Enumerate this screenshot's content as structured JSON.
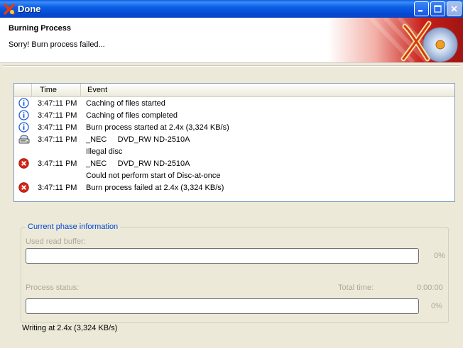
{
  "window": {
    "title": "Done",
    "controls": [
      "minimize",
      "maximize",
      "close"
    ]
  },
  "header": {
    "title": "Burning Process",
    "subtitle": "Sorry! Burn process failed..."
  },
  "event_list": {
    "columns": [
      "Time",
      "Event"
    ],
    "rows": [
      {
        "icon": "info-icon",
        "time": "3:47:11 PM",
        "event": "Caching of files started"
      },
      {
        "icon": "info-icon",
        "time": "3:47:11 PM",
        "event": "Caching of files completed"
      },
      {
        "icon": "info-icon",
        "time": "3:47:11 PM",
        "event": "Burn process started at 2.4x (3,324 KB/s)"
      },
      {
        "icon": "drive-icon",
        "time": "3:47:11 PM",
        "event": "_NEC     DVD_RW ND-2510A"
      },
      {
        "icon": "",
        "time": "",
        "event": "Illegal disc"
      },
      {
        "icon": "error-icon",
        "time": "3:47:11 PM",
        "event": "_NEC     DVD_RW ND-2510A"
      },
      {
        "icon": "",
        "time": "",
        "event": "Could not perform start of Disc-at-once"
      },
      {
        "icon": "error-icon",
        "time": "3:47:11 PM",
        "event": "Burn process failed at 2.4x (3,324 KB/s)"
      }
    ]
  },
  "phase": {
    "legend": "Current phase information",
    "buffer_label": "Used read buffer:",
    "buffer_percent": "0%",
    "buffer_value": 0,
    "status_label": "Process status:",
    "total_time_label": "Total time:",
    "total_time_value": "0:00:00",
    "status_percent": "0%",
    "status_value": 0
  },
  "status_line": "Writing at 2.4x (3,324 KB/s)",
  "colors": {
    "titlebar": "#0b5fe6",
    "info": "#1c5ad6",
    "error": "#d8261a",
    "legend": "#0046d5",
    "disabled_text": "#aca899"
  }
}
